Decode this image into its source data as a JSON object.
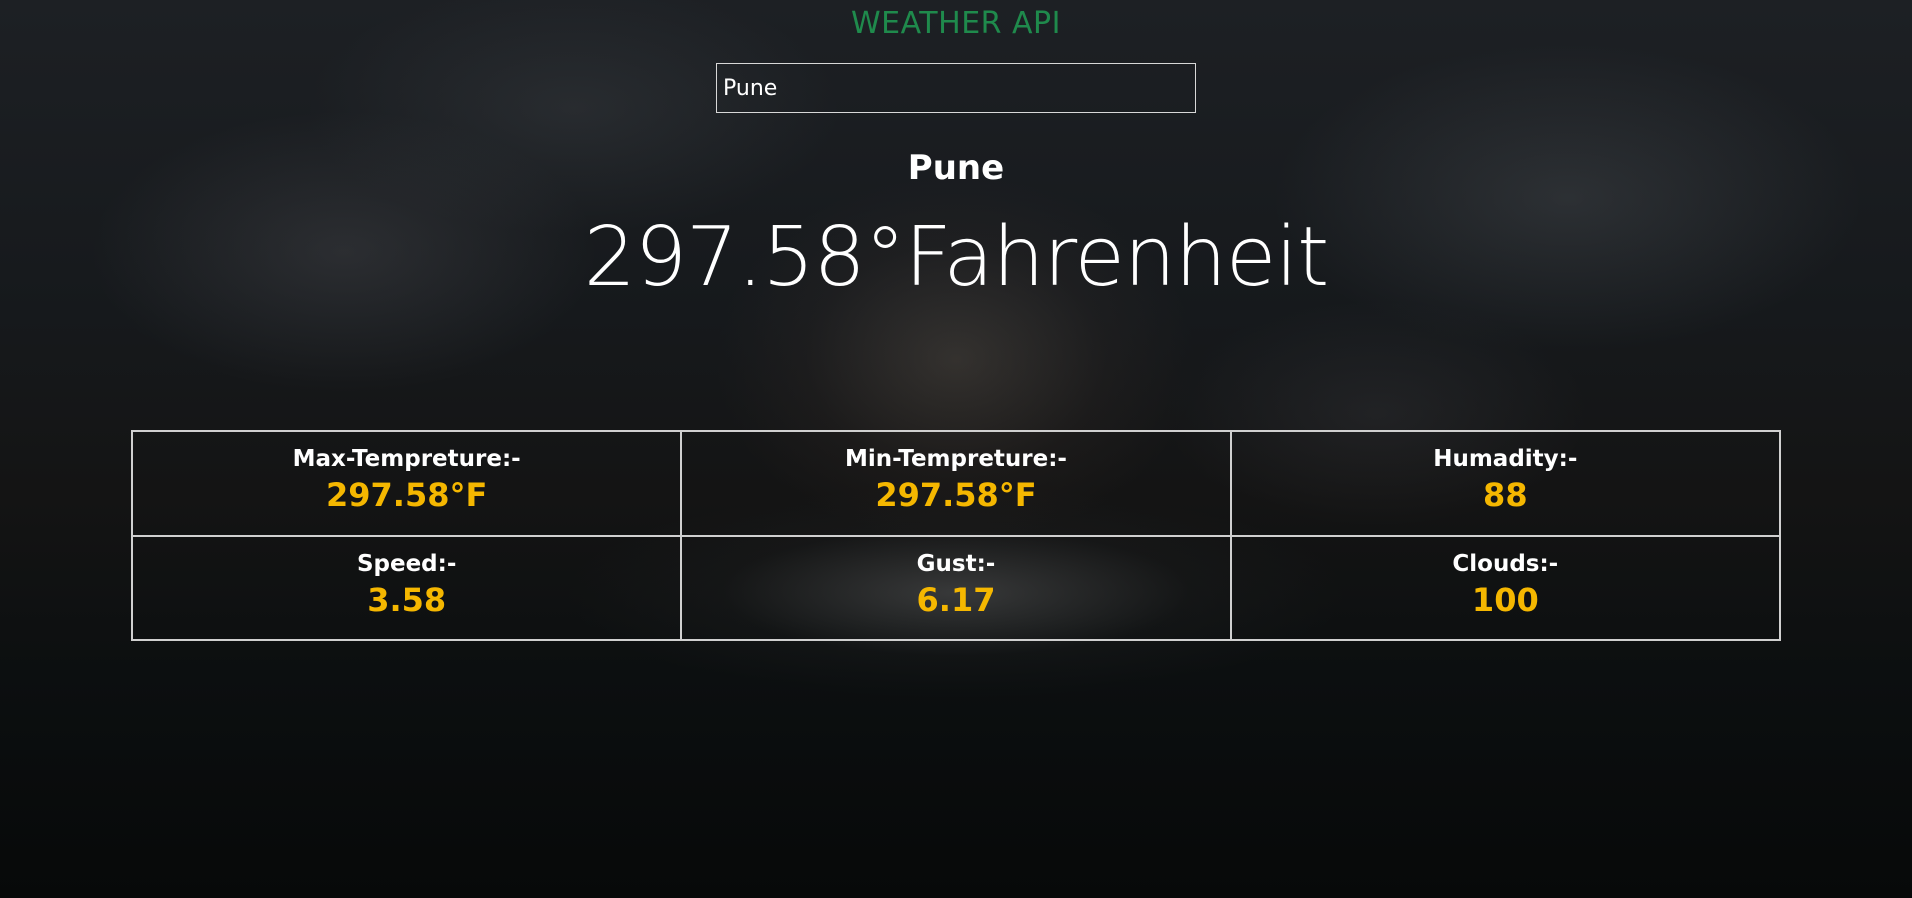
{
  "colors": {
    "title": "#1f8a4c",
    "value": "#f5b700",
    "text": "#ffffff",
    "border": "#d0d0d0"
  },
  "header": {
    "title": "WEATHER API"
  },
  "search": {
    "value": "Pune",
    "placeholder": ""
  },
  "weather": {
    "city": "Pune",
    "temperature": "297.58°Fahrenheit"
  },
  "stats": [
    {
      "label": "Max-Tempreture:-",
      "value": "297.58°F"
    },
    {
      "label": "Min-Tempreture:-",
      "value": "297.58°F"
    },
    {
      "label": "Humadity:-",
      "value": "88"
    },
    {
      "label": "Speed:-",
      "value": "3.58"
    },
    {
      "label": "Gust:-",
      "value": "6.17"
    },
    {
      "label": "Clouds:-",
      "value": "100"
    }
  ]
}
